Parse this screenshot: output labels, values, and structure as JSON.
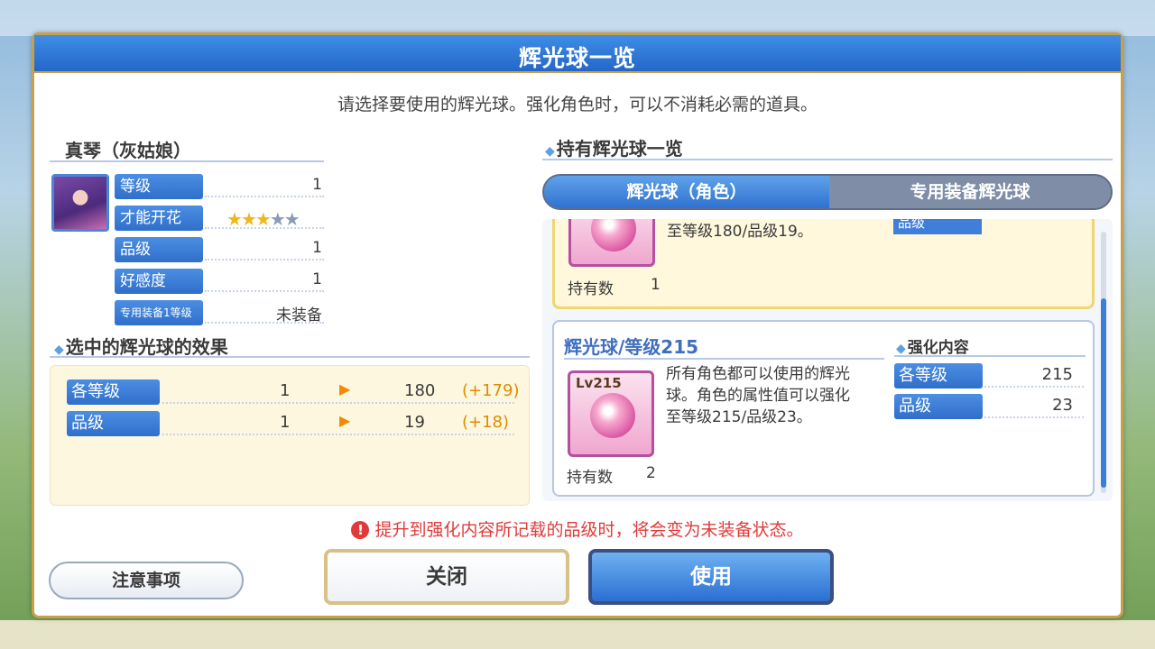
{
  "dialog": {
    "title": "辉光球一览",
    "subtitle": "请选择要使用的辉光球。强化角色时，可以不消耗必需的道具。"
  },
  "character": {
    "name": "真琴（灰姑娘）",
    "stats": [
      {
        "label": "等级",
        "value": "1"
      },
      {
        "label": "才能开花",
        "stars_filled": 3,
        "stars_total": 5
      },
      {
        "label": "品级",
        "value": "1"
      },
      {
        "label": "好感度",
        "value": "1"
      },
      {
        "label": "专用装备1等级",
        "value": "未装备"
      }
    ]
  },
  "effect": {
    "heading": "选中的辉光球的效果",
    "rows": [
      {
        "label": "各等级",
        "current": "1",
        "new": "180",
        "diff": "(+179)"
      },
      {
        "label": "品级",
        "current": "1",
        "new": "19",
        "diff": "(+18)"
      }
    ]
  },
  "owned": {
    "heading": "持有辉光球一览",
    "tabs": [
      {
        "label": "辉光球（角色）",
        "active": true
      },
      {
        "label": "专用装备辉光球",
        "active": false
      }
    ],
    "cards": [
      {
        "desc_tail": "至等级180/品级19。",
        "own_label": "持有数",
        "own_count": "1",
        "partial_label": "品级"
      },
      {
        "title": "辉光球/等级215",
        "orb_level": "Lv215",
        "desc_lines": [
          "所有角色都可以使用的辉光",
          "球。角色的属性值可以强化",
          "至等级215/品级23。"
        ],
        "own_label": "持有数",
        "own_count": "2",
        "enhance_heading": "强化内容",
        "enhance": [
          {
            "label": "各等级",
            "value": "215"
          },
          {
            "label": "品级",
            "value": "23"
          }
        ]
      }
    ]
  },
  "warning": "提升到强化内容所记载的品级时，将会变为未装备状态。",
  "buttons": {
    "note": "注意事项",
    "close": "关闭",
    "use": "使用"
  }
}
